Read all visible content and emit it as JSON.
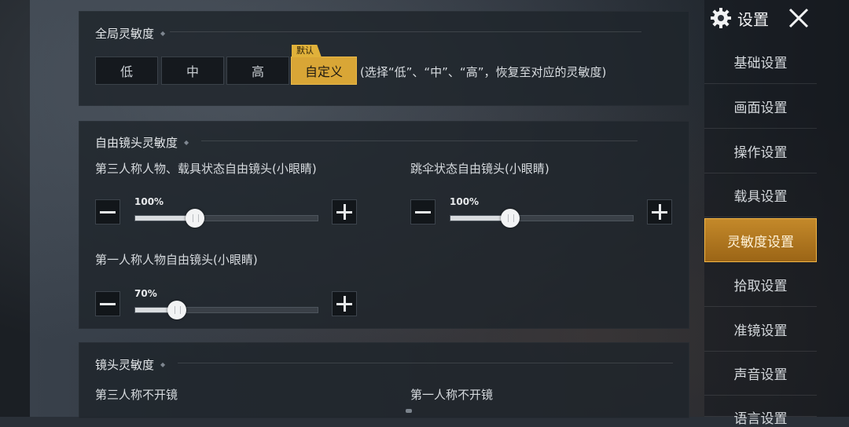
{
  "sidebar": {
    "title": "设置",
    "items": [
      {
        "label": "基础设置"
      },
      {
        "label": "画面设置"
      },
      {
        "label": "操作设置"
      },
      {
        "label": "载具设置"
      },
      {
        "label": "灵敏度设置"
      },
      {
        "label": "拾取设置"
      },
      {
        "label": "准镜设置"
      },
      {
        "label": "声音设置"
      },
      {
        "label": "语言设置"
      }
    ]
  },
  "global": {
    "title": "全局灵敏度",
    "options": [
      "低",
      "中",
      "高",
      "自定义"
    ],
    "selected": "自定义",
    "default_tag": "默认",
    "hint": "(选择“低”、“中”、“高”，恢复至对应的灵敏度)"
  },
  "free_camera": {
    "title": "自由镜头灵敏度",
    "sliders": [
      {
        "label": "第三人称人物、载具状态自由镜头(小眼睛)",
        "value_text": "100%",
        "value": 0.33
      },
      {
        "label": "跳伞状态自由镜头(小眼睛)",
        "value_text": "100%",
        "value": 0.33
      },
      {
        "label": "第一人称人物自由镜头(小眼睛)",
        "value_text": "70%",
        "value": 0.23
      }
    ]
  },
  "camera": {
    "title": "镜头灵敏度",
    "labels": [
      "第三人称不开镜",
      "第一人称不开镜"
    ]
  },
  "icons": {
    "settings": "gear-icon",
    "close": "close-icon",
    "minus": "minus-icon",
    "plus": "plus-icon"
  },
  "colors": {
    "accent": "#d9a636",
    "active_tab": "#c4892a"
  }
}
